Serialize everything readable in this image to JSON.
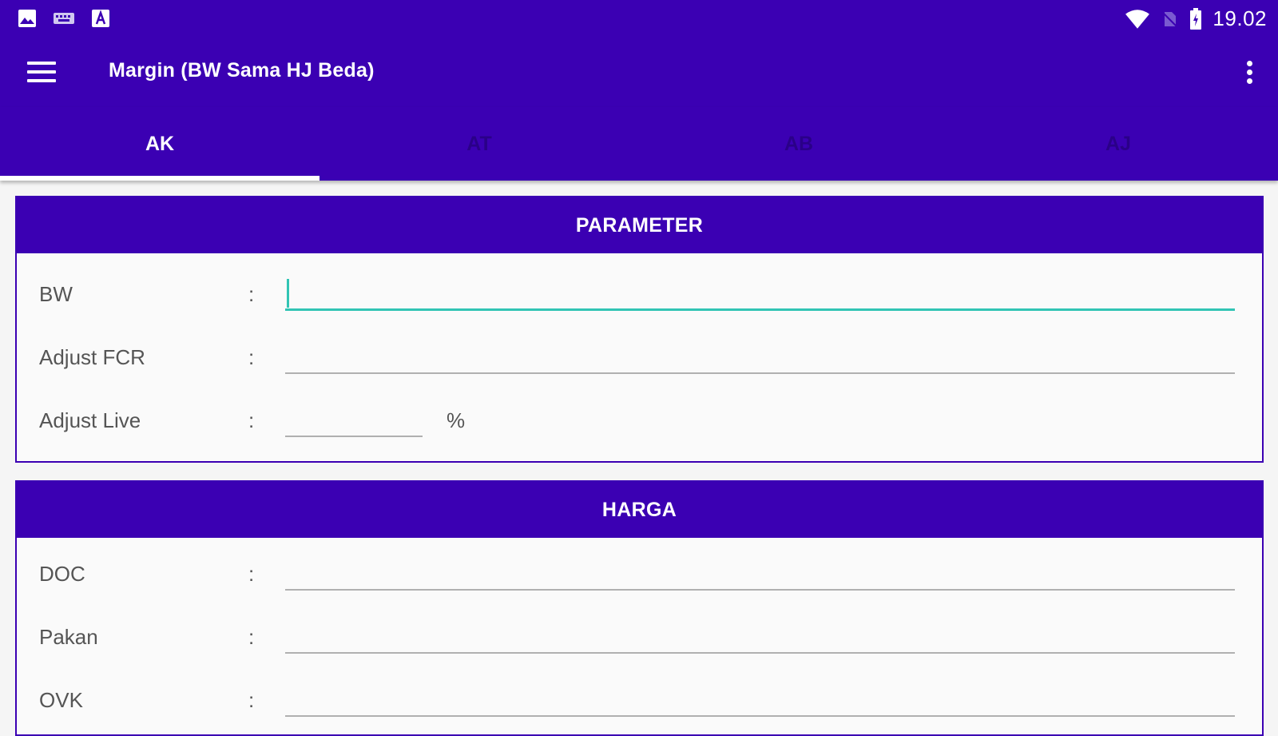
{
  "status_bar": {
    "time": "19.02",
    "left_icons": [
      "image-icon",
      "keyboard-icon",
      "text-a-icon"
    ],
    "right_icons": [
      "wifi-icon",
      "no-sim-icon",
      "battery-charging-icon"
    ]
  },
  "app_bar": {
    "title": "Margin (BW Sama HJ Beda)",
    "menu_icon": "hamburger-menu-icon",
    "overflow_icon": "more-vert-icon"
  },
  "tabs": [
    {
      "label": "AK",
      "active": true
    },
    {
      "label": "AT",
      "active": false
    },
    {
      "label": "AB",
      "active": false
    },
    {
      "label": "AJ",
      "active": false
    }
  ],
  "parameter": {
    "title": "PARAMETER",
    "fields": [
      {
        "label": "BW",
        "colon": ":",
        "value": ""
      },
      {
        "label": "Adjust FCR",
        "colon": ":",
        "value": ""
      },
      {
        "label": "Adjust Live",
        "colon": ":",
        "value": "",
        "unit": "%"
      }
    ]
  },
  "harga": {
    "title": "HARGA",
    "fields": [
      {
        "label": "DOC",
        "colon": ":",
        "value": ""
      },
      {
        "label": "Pakan",
        "colon": ":",
        "value": ""
      },
      {
        "label": "OVK",
        "colon": ":",
        "value": ""
      }
    ]
  },
  "colors": {
    "primary": "#3b00b3",
    "accent": "#31c4b4",
    "inactive_tab_text": "#2a0088"
  }
}
